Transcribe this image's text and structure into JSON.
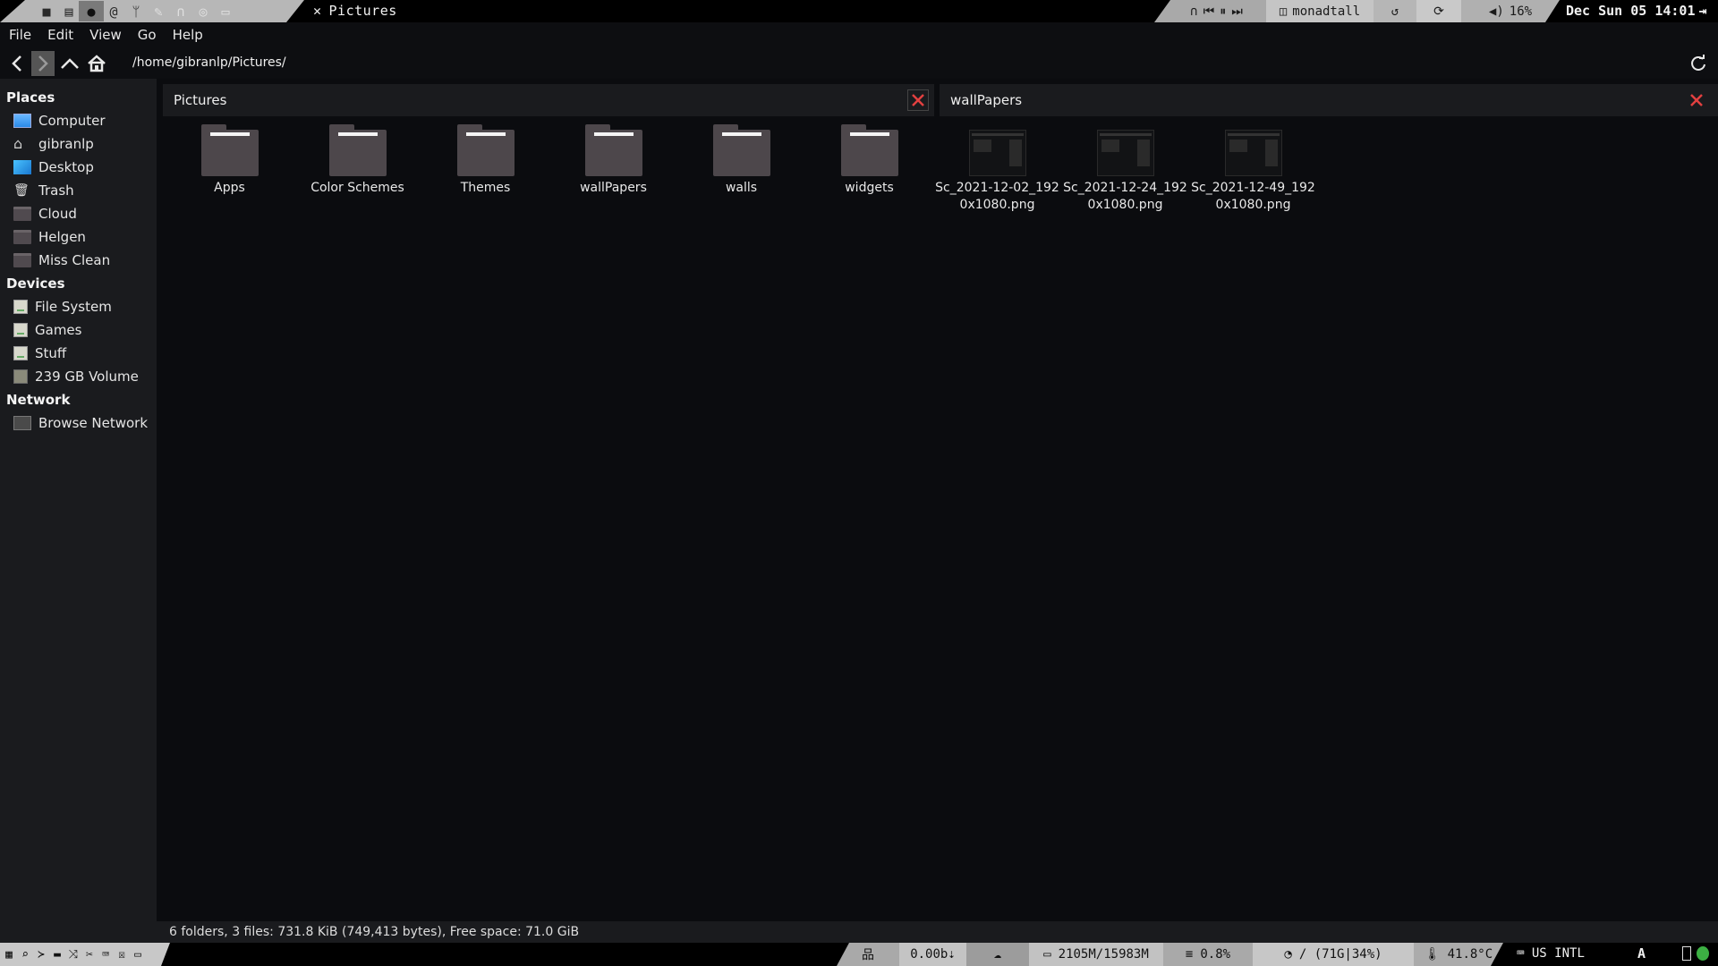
{
  "topbar": {
    "workspaces": [
      {
        "icon": "camera-icon",
        "glyph": "■"
      },
      {
        "icon": "web-icon",
        "glyph": "▤"
      },
      {
        "icon": "chat-icon",
        "glyph": "●"
      },
      {
        "icon": "mail-icon",
        "glyph": "@"
      },
      {
        "icon": "git-icon",
        "glyph": "ᛘ"
      },
      {
        "icon": "brush-icon",
        "glyph": "✎"
      },
      {
        "icon": "headphones-icon",
        "glyph": "∩"
      },
      {
        "icon": "steam-icon",
        "glyph": "◎"
      },
      {
        "icon": "monitor-icon",
        "glyph": "▭"
      }
    ],
    "window_title": "Pictures",
    "layout": "monadtall",
    "volume": "16%",
    "clock": "Dec Sun 05 14:01"
  },
  "menu": [
    "File",
    "Edit",
    "View",
    "Go",
    "Help"
  ],
  "location": {
    "path": "/home/gibranlp/Pictures/"
  },
  "sidebar": {
    "places_header": "Places",
    "places": [
      {
        "label": "Computer",
        "icon": "computer-icon"
      },
      {
        "label": "gibranlp",
        "icon": "home-icon"
      },
      {
        "label": "Desktop",
        "icon": "desktop-icon"
      },
      {
        "label": "Trash",
        "icon": "trash-icon"
      },
      {
        "label": "Cloud",
        "icon": "folder-icon"
      },
      {
        "label": "Helgen",
        "icon": "folder-icon"
      },
      {
        "label": "Miss Clean",
        "icon": "folder-icon"
      }
    ],
    "devices_header": "Devices",
    "devices": [
      {
        "label": "File System",
        "icon": "drive-icon"
      },
      {
        "label": "Games",
        "icon": "drive-icon"
      },
      {
        "label": "Stuff",
        "icon": "drive-icon"
      },
      {
        "label": "239 GB Volume",
        "icon": "drive-icon"
      }
    ],
    "network_header": "Network",
    "network": [
      {
        "label": "Browse Network",
        "icon": "network-icon"
      }
    ]
  },
  "panes": {
    "left_title": "Pictures",
    "right_title": "wallPapers"
  },
  "files": [
    {
      "name": "Apps",
      "type": "folder"
    },
    {
      "name": "Color Schemes",
      "type": "folder"
    },
    {
      "name": "Themes",
      "type": "folder"
    },
    {
      "name": "wallPapers",
      "type": "folder"
    },
    {
      "name": "walls",
      "type": "folder"
    },
    {
      "name": "widgets",
      "type": "folder"
    },
    {
      "name": "Sc_2021-12-02_1920x1080.png",
      "line1": "Sc_2021-12-02_192",
      "line2": "0x1080.png",
      "type": "image"
    },
    {
      "name": "Sc_2021-12-24_1920x1080.png",
      "line1": "Sc_2021-12-24_192",
      "line2": "0x1080.png",
      "type": "image"
    },
    {
      "name": "Sc_2021-12-49_1920x1080.png",
      "line1": "Sc_2021-12-49_192",
      "line2": "0x1080.png",
      "type": "image"
    }
  ],
  "status": "6 folders, 3 files: 731.8 KiB (749,413 bytes), Free space: 71.0 GiB",
  "bottombar": {
    "net_speed": "0.00b⇣",
    "memory": "2105M/15983M",
    "cpu": "0.8%",
    "disk": "/ (71G|34%)",
    "temp": "41.8°C",
    "keyboard": "US INTL"
  }
}
